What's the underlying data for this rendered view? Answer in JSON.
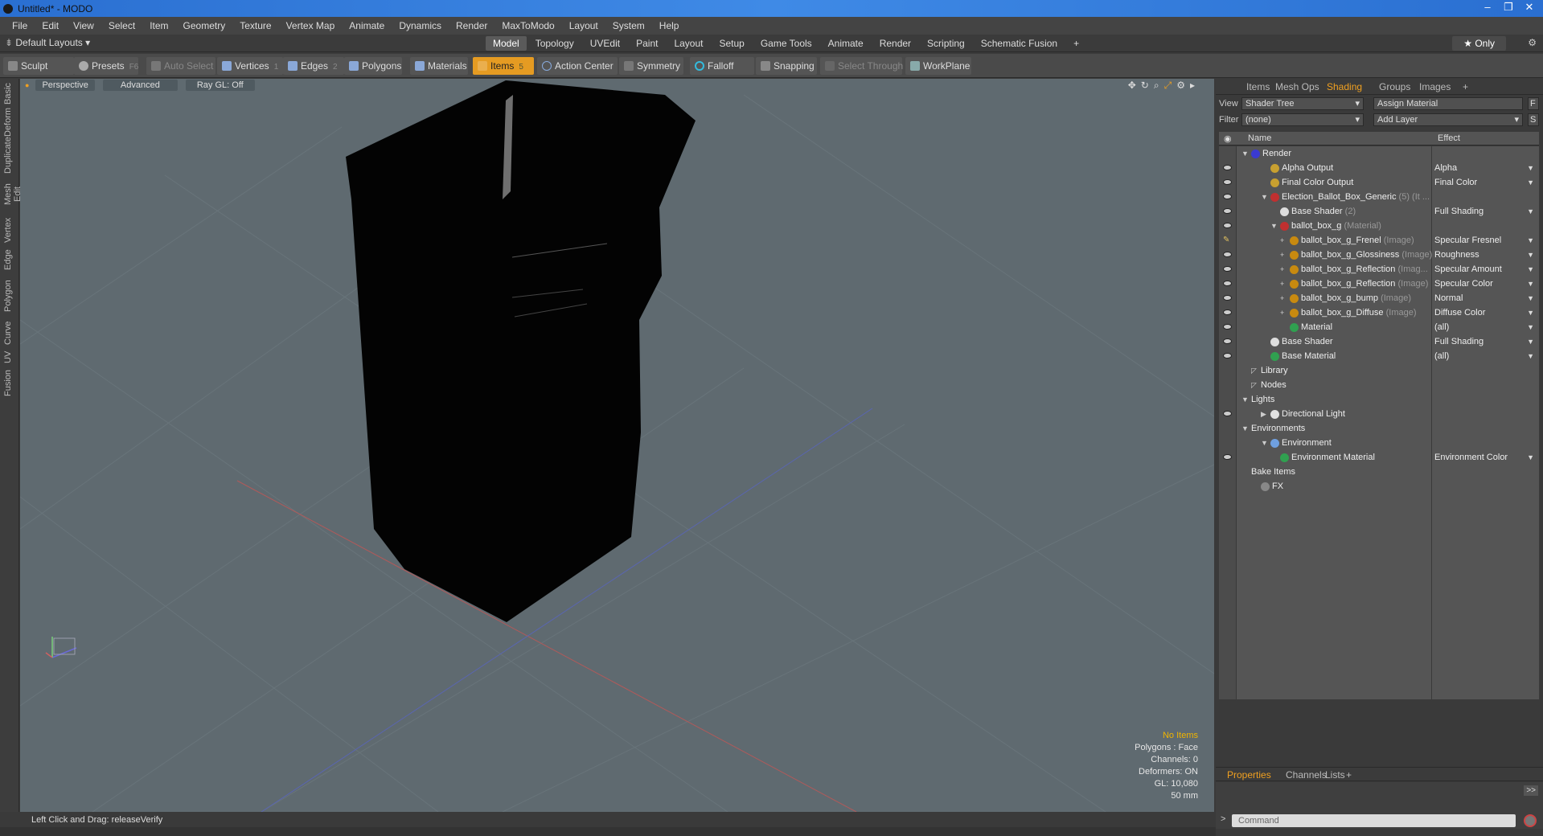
{
  "window": {
    "title": "Untitled* - MODO"
  },
  "menu": [
    "File",
    "Edit",
    "View",
    "Select",
    "Item",
    "Geometry",
    "Texture",
    "Vertex Map",
    "Animate",
    "Dynamics",
    "Render",
    "MaxToModo",
    "Layout",
    "System",
    "Help"
  ],
  "layout": {
    "label": "Default Layouts ▾"
  },
  "tabs": [
    {
      "label": "Model",
      "active": true
    },
    {
      "label": "Topology"
    },
    {
      "label": "UVEdit"
    },
    {
      "label": "Paint"
    },
    {
      "label": "Layout"
    },
    {
      "label": "Setup"
    },
    {
      "label": "Game Tools"
    },
    {
      "label": "Animate"
    },
    {
      "label": "Render"
    },
    {
      "label": "Scripting"
    },
    {
      "label": "Schematic Fusion"
    },
    {
      "label": "+"
    }
  ],
  "only_label": "★  Only",
  "toolbar": {
    "sculpt": "Sculpt",
    "presets": "Presets",
    "presets_key": "F6",
    "auto_select": "Auto Select",
    "vertices": "Vertices",
    "vertices_key": "1",
    "edges": "Edges",
    "edges_key": "2",
    "polygons": "Polygons",
    "materials": "Materials",
    "items": "Items",
    "items_key": "5",
    "action_center": "Action Center",
    "symmetry": "Symmetry",
    "falloff": "Falloff",
    "snapping": "Snapping",
    "select_through": "Select Through",
    "workplane": "WorkPlane"
  },
  "left_tabs": [
    "Basic",
    "Deform",
    "Duplicate",
    "Mesh Edit",
    "Vertex",
    "Edge",
    "Polygon",
    "Curve",
    "UV",
    "Fusion"
  ],
  "viewport": {
    "perspective": "Perspective",
    "advanced": "Advanced",
    "raygl": "Ray GL: Off",
    "info": {
      "items": "No Items",
      "polygons": "Polygons : Face",
      "channels": "Channels: 0",
      "deformers": "Deformers: ON",
      "gl": "GL: 10,080",
      "focal": "50 mm"
    }
  },
  "status": "Left Click and Drag:   releaseVerify",
  "panel": {
    "tabs": [
      "Items",
      "Mesh Ops",
      "Shading",
      "Groups",
      "Images",
      "+"
    ],
    "active_tab": "Shading",
    "view_label": "View",
    "view_value": "Shader Tree",
    "assign": "Assign Material",
    "f_btn": "F",
    "filter_label": "Filter",
    "filter_value": "(none)",
    "add_layer": "Add Layer",
    "s_btn": "S",
    "col_name": "Name",
    "col_effect": "Effect",
    "tree": [
      {
        "name": "Render",
        "depth": 0,
        "eye": false,
        "tw": "▼",
        "icon": "#3a3ad0",
        "effect": ""
      },
      {
        "name": "Alpha Output",
        "depth": 2,
        "eye": true,
        "icon": "#c8a030",
        "effect": "Alpha"
      },
      {
        "name": "Final Color Output",
        "depth": 2,
        "eye": true,
        "icon": "#c8a030",
        "effect": "Final Color"
      },
      {
        "name": "Election_Ballot_Box_Generic",
        "suffix": " (5) (It ...",
        "depth": 2,
        "eye": true,
        "tw": "▼",
        "icon": "#c03030",
        "effect": ""
      },
      {
        "name": "Base Shader",
        "suffix": " (2)",
        "depth": 3,
        "eye": true,
        "icon": "#dddddd",
        "effect": "Full Shading"
      },
      {
        "name": "ballot_box_g",
        "suffix": " (Material)",
        "depth": 3,
        "eye": true,
        "tw": "▼",
        "icon": "#c03030",
        "effect": ""
      },
      {
        "name": "ballot_box_g_Frenel",
        "suffix": " (Image)",
        "depth": 4,
        "eye": "pen",
        "tw": "+",
        "icon": "#c88a10",
        "effect": "Specular Fresnel"
      },
      {
        "name": "ballot_box_g_Glossiness",
        "suffix": " (Image)",
        "depth": 4,
        "eye": true,
        "tw": "+",
        "icon": "#c88a10",
        "effect": "Roughness"
      },
      {
        "name": "ballot_box_g_Reflection",
        "suffix": " (Imag...",
        "depth": 4,
        "eye": true,
        "tw": "+",
        "icon": "#c88a10",
        "effect": "Specular Amount"
      },
      {
        "name": "ballot_box_g_Reflection",
        "suffix": " (Image)",
        "depth": 4,
        "eye": true,
        "tw": "+",
        "icon": "#c88a10",
        "effect": "Specular Color"
      },
      {
        "name": "ballot_box_g_bump",
        "suffix": " (Image)",
        "depth": 4,
        "eye": true,
        "tw": "+",
        "icon": "#c88a10",
        "effect": "Normal"
      },
      {
        "name": "ballot_box_g_Diffuse",
        "suffix": " (Image)",
        "depth": 4,
        "eye": true,
        "tw": "+",
        "icon": "#c88a10",
        "effect": "Diffuse Color"
      },
      {
        "name": "Material",
        "depth": 4,
        "eye": true,
        "icon": "#30a050",
        "effect": "(all)"
      },
      {
        "name": "Base Shader",
        "depth": 2,
        "eye": true,
        "icon": "#dddddd",
        "effect": "Full Shading"
      },
      {
        "name": "Base Material",
        "depth": 2,
        "eye": true,
        "icon": "#30a050",
        "effect": "(all)"
      },
      {
        "name": "Library",
        "depth": 1,
        "eye": false,
        "tw": "◸",
        "effect": ""
      },
      {
        "name": "Nodes",
        "depth": 1,
        "eye": false,
        "tw": "◸",
        "effect": ""
      },
      {
        "name": "Lights",
        "depth": 0,
        "eye": false,
        "tw": "▼",
        "effect": ""
      },
      {
        "name": "Directional Light",
        "depth": 2,
        "eye": true,
        "tw": "▶",
        "icon": "#e0e0e0",
        "effect": ""
      },
      {
        "name": "Environments",
        "depth": 0,
        "eye": false,
        "tw": "▼",
        "effect": ""
      },
      {
        "name": "Environment",
        "depth": 2,
        "eye": false,
        "tw": "▼",
        "icon": "#6fa0e0",
        "effect": ""
      },
      {
        "name": "Environment Material",
        "depth": 3,
        "eye": true,
        "icon": "#30a050",
        "effect": "Environment Color"
      },
      {
        "name": "Bake Items",
        "depth": 0,
        "eye": false,
        "effect": ""
      },
      {
        "name": "FX",
        "depth": 1,
        "eye": false,
        "icon": "#888888",
        "effect": ""
      }
    ],
    "prop_tabs": [
      "Properties",
      "Channels",
      "Lists",
      "+"
    ],
    "command_placeholder": "Command"
  },
  "colors": {
    "accent": "#f0a020",
    "items_active": "#e59b22",
    "viewport_bg": "#5f6a70"
  }
}
